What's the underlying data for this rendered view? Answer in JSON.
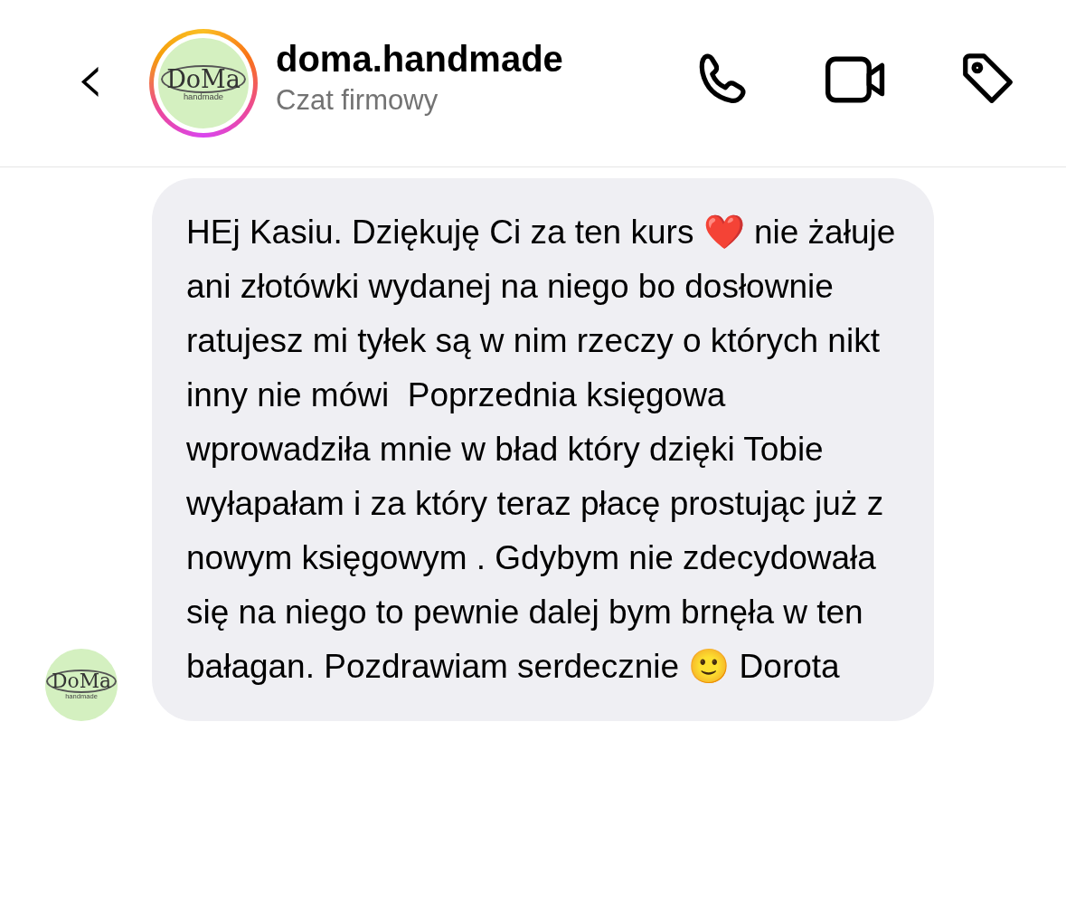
{
  "header": {
    "back": "‹",
    "title": "doma.handmade",
    "subtitle": "Czat firmowy",
    "avatar": {
      "logo": "DoMa",
      "logo_sub": "handmade",
      "story_ring": true
    }
  },
  "messages": [
    {
      "sender_avatar": {
        "logo": "DoMa",
        "logo_sub": "handmade"
      },
      "text": "HEj Kasiu. Dziękuję Ci za ten kurs ❤️ nie żałuje ani złotówki wydanej na niego bo dosłownie ratujesz mi tyłek są w nim rzeczy o których nikt inny nie mówi  Poprzednia księgowa wprowadziła mnie w bład który dzięki Tobie wyłapałam i za który teraz płacę prostując już z nowym księgowym . Gdybym nie zdecydowała się na niego to pewnie dalej bym brnęła w ten bałagan. Pozdrawiam serdecznie 🙂 Dorota"
    }
  ]
}
